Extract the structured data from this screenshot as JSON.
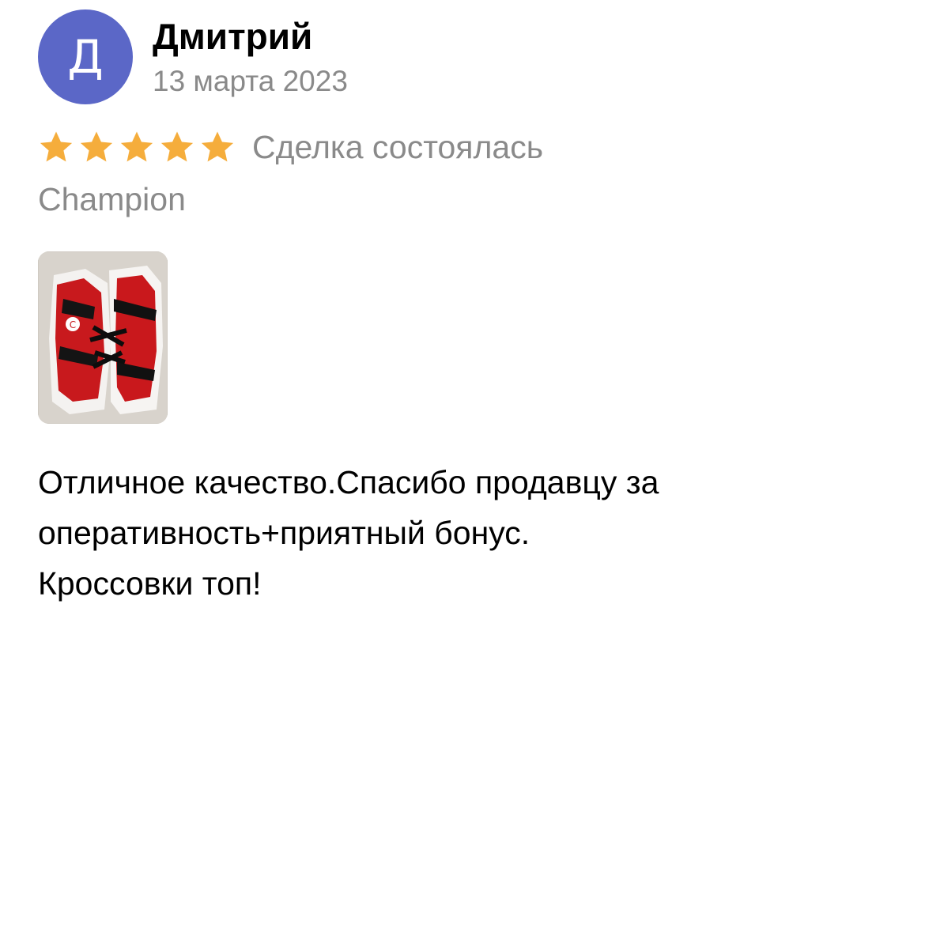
{
  "author": {
    "name": "Дмитрий",
    "initial": "Д",
    "avatar_color": "#5b67c7"
  },
  "date": "13 марта 2023",
  "rating": {
    "stars": 5,
    "max": 5,
    "star_color": "#f5ad3c",
    "status": "Сделка состоялась"
  },
  "product": "Champion",
  "photo": {
    "icon": "sneakers-photo"
  },
  "review_lines": [
    "Отличное качество.Спасибо продавцу за",
    "оперативность+приятный бонус.",
    "Кроссовки топ!"
  ]
}
